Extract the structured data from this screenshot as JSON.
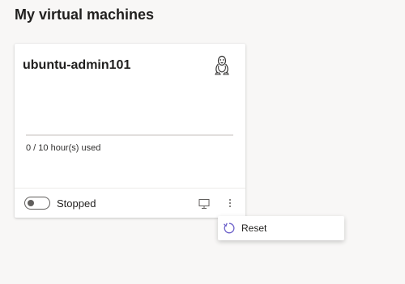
{
  "page": {
    "title": "My virtual machines"
  },
  "vm": {
    "name": "ubuntu-admin101",
    "os_icon": "linux-penguin-icon",
    "usage_text": "0 / 10 hour(s) used",
    "usage_fraction": 0,
    "status": "Stopped",
    "toggle_on": false,
    "connect_icon": "monitor-icon",
    "more_icon": "more-vertical-icon"
  },
  "context_menu": {
    "items": [
      {
        "label": "Reset",
        "icon": "reset-icon"
      }
    ]
  },
  "colors": {
    "background": "#f8f7f6",
    "accent": "#0078d4",
    "menu_icon": "#6b5fc9"
  }
}
